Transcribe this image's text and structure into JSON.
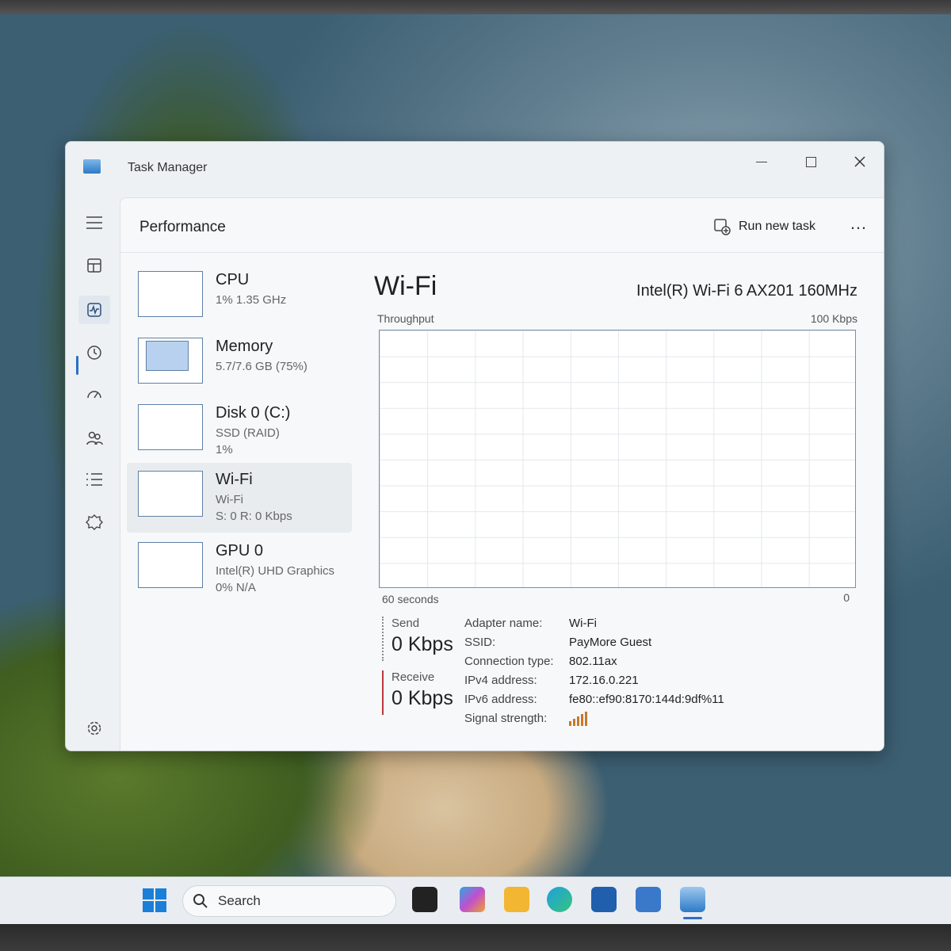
{
  "window": {
    "title": "Task Manager",
    "page_title": "Performance",
    "run_new_task_label": "Run new task",
    "more_label": "…"
  },
  "rail": {
    "icons": [
      "hamburger-icon",
      "processes-icon",
      "performance-icon",
      "app-history-icon",
      "startup-apps-icon",
      "users-icon",
      "details-icon",
      "services-icon",
      "settings-icon"
    ],
    "active": "performance-icon"
  },
  "resources": [
    {
      "name": "CPU",
      "line1": "1%  1.35 GHz",
      "line2": ""
    },
    {
      "name": "Memory",
      "line1": "5.7/7.6 GB (75%)",
      "line2": ""
    },
    {
      "name": "Disk 0 (C:)",
      "line1": "SSD (RAID)",
      "line2": "1%"
    },
    {
      "name": "Wi-Fi",
      "line1": "Wi-Fi",
      "line2": "S: 0 R: 0 Kbps"
    },
    {
      "name": "GPU 0",
      "line1": "Intel(R) UHD Graphics",
      "line2": "0% N/A"
    }
  ],
  "selected_resource": "Wi-Fi",
  "detail": {
    "title": "Wi-Fi",
    "adapter_model": "Intel(R) Wi-Fi 6 AX201 160MHz",
    "graph_label": "Throughput",
    "graph_max": "100 Kbps",
    "graph_time": "60 seconds",
    "graph_min": "0",
    "send_label": "Send",
    "send_value": "0 Kbps",
    "receive_label": "Receive",
    "receive_value": "0 Kbps",
    "properties": [
      {
        "key": "Adapter name:",
        "value": "Wi-Fi"
      },
      {
        "key": "SSID:",
        "value": "PayMore Guest"
      },
      {
        "key": "Connection type:",
        "value": "802.11ax"
      },
      {
        "key": "IPv4 address:",
        "value": "172.16.0.221"
      },
      {
        "key": "IPv6 address:",
        "value": "fe80::ef90:8170:144d:9df%11"
      },
      {
        "key": "Signal strength:",
        "value": ""
      }
    ],
    "signal_bars": 5
  },
  "taskbar": {
    "search_label": "Search",
    "apps": [
      "widgets-icon",
      "task-view-icon",
      "copilot-m365-icon",
      "file-explorer-icon",
      "edge-icon",
      "microsoft-store-icon",
      "company-portal-icon",
      "task-manager-icon"
    ]
  },
  "colors": {
    "accent": "#2b6fc7",
    "receive_accent": "#b8383c",
    "signal": "#c47a2a"
  }
}
